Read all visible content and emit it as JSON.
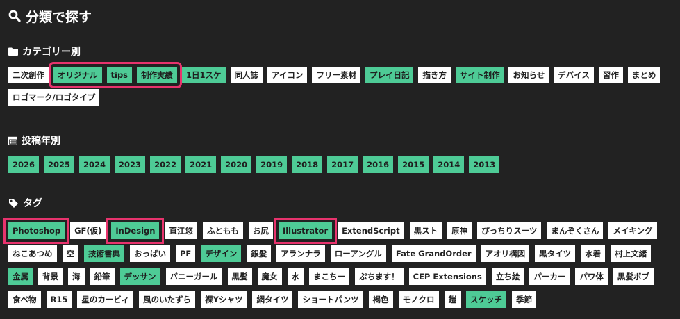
{
  "page_title": "分類で探す",
  "sections": {
    "category": {
      "title": "カテゴリー別",
      "tags_before": [
        {
          "label": "二次創作",
          "active": false
        }
      ],
      "tags_group": [
        {
          "label": "オリジナル",
          "active": true
        },
        {
          "label": "tips",
          "active": true
        },
        {
          "label": "制作実績",
          "active": true
        }
      ],
      "tags_after": [
        {
          "label": "1日1スケ",
          "active": true
        },
        {
          "label": "同人誌",
          "active": false
        },
        {
          "label": "アイコン",
          "active": false
        },
        {
          "label": "フリー素材",
          "active": false
        },
        {
          "label": "プレイ日記",
          "active": true
        },
        {
          "label": "描き方",
          "active": false
        },
        {
          "label": "サイト制作",
          "active": true
        },
        {
          "label": "お知らせ",
          "active": false
        },
        {
          "label": "デバイス",
          "active": false
        },
        {
          "label": "習作",
          "active": false
        },
        {
          "label": "まとめ",
          "active": false
        },
        {
          "label": "ロゴマーク/ロゴタイプ",
          "active": false
        }
      ]
    },
    "year": {
      "title": "投稿年別",
      "tags": [
        {
          "label": "2026",
          "active": true
        },
        {
          "label": "2025",
          "active": true
        },
        {
          "label": "2024",
          "active": true
        },
        {
          "label": "2023",
          "active": true
        },
        {
          "label": "2022",
          "active": true
        },
        {
          "label": "2021",
          "active": true
        },
        {
          "label": "2020",
          "active": true
        },
        {
          "label": "2019",
          "active": true
        },
        {
          "label": "2018",
          "active": true
        },
        {
          "label": "2017",
          "active": true
        },
        {
          "label": "2016",
          "active": true
        },
        {
          "label": "2015",
          "active": true
        },
        {
          "label": "2014",
          "active": true
        },
        {
          "label": "2013",
          "active": true
        }
      ]
    },
    "tags": {
      "title": "タグ",
      "tags": [
        {
          "label": "Photoshop",
          "active": true,
          "highlight": true
        },
        {
          "label": "GF(仮)",
          "active": false
        },
        {
          "label": "InDesign",
          "active": true,
          "highlight": true
        },
        {
          "label": "直江悠",
          "active": false
        },
        {
          "label": "ふともも",
          "active": false
        },
        {
          "label": "お尻",
          "active": false
        },
        {
          "label": "Illustrator",
          "active": true,
          "highlight": true
        },
        {
          "label": "ExtendScript",
          "active": false
        },
        {
          "label": "黒スト",
          "active": false
        },
        {
          "label": "原神",
          "active": false
        },
        {
          "label": "ぴっちりスーツ",
          "active": false
        },
        {
          "label": "まんぞくさん",
          "active": false
        },
        {
          "label": "メイキング",
          "active": false
        },
        {
          "label": "ねこあつめ",
          "active": false
        },
        {
          "label": "空",
          "active": false
        },
        {
          "label": "技術書典",
          "active": true
        },
        {
          "label": "おっぱい",
          "active": false
        },
        {
          "label": "PF",
          "active": false
        },
        {
          "label": "デザイン",
          "active": true
        },
        {
          "label": "銀髪",
          "active": false
        },
        {
          "label": "アランナラ",
          "active": false
        },
        {
          "label": "ローアングル",
          "active": false
        },
        {
          "label": "Fate GrandOrder",
          "active": false
        },
        {
          "label": "アオリ構図",
          "active": false
        },
        {
          "label": "黒タイツ",
          "active": false
        },
        {
          "label": "水着",
          "active": false
        },
        {
          "label": "村上文緒",
          "active": false
        },
        {
          "label": "金属",
          "active": true
        },
        {
          "label": "背景",
          "active": false
        },
        {
          "label": "海",
          "active": false
        },
        {
          "label": "鉛筆",
          "active": false
        },
        {
          "label": "デッサン",
          "active": true
        },
        {
          "label": "バニーガール",
          "active": false
        },
        {
          "label": "黒髪",
          "active": false
        },
        {
          "label": "魔女",
          "active": false
        },
        {
          "label": "水",
          "active": false
        },
        {
          "label": "まこちー",
          "active": false
        },
        {
          "label": "ぷちます！",
          "active": false
        },
        {
          "label": "CEP Extensions",
          "active": false
        },
        {
          "label": "立ち絵",
          "active": false
        },
        {
          "label": "パーカー",
          "active": false
        },
        {
          "label": "パワ体",
          "active": false
        },
        {
          "label": "黒髪ボブ",
          "active": false
        },
        {
          "label": "食べ物",
          "active": false
        },
        {
          "label": "R15",
          "active": false
        },
        {
          "label": "星のカービィ",
          "active": false
        },
        {
          "label": "風のいたずら",
          "active": false
        },
        {
          "label": "裸Yシャツ",
          "active": false
        },
        {
          "label": "網タイツ",
          "active": false
        },
        {
          "label": "ショートパンツ",
          "active": false
        },
        {
          "label": "褐色",
          "active": false
        },
        {
          "label": "モノクロ",
          "active": false
        },
        {
          "label": "鎧",
          "active": false
        },
        {
          "label": "スケッチ",
          "active": true
        },
        {
          "label": "季節",
          "active": false
        }
      ]
    }
  },
  "colors": {
    "background": "#222222",
    "tag_default": "#ffffff",
    "tag_active": "#4ecb96",
    "highlight_outline": "#e8336d"
  },
  "icons": {
    "title": "search-icon",
    "category": "folder-icon",
    "year": "calendar-icon",
    "tags": "tag-icon"
  }
}
